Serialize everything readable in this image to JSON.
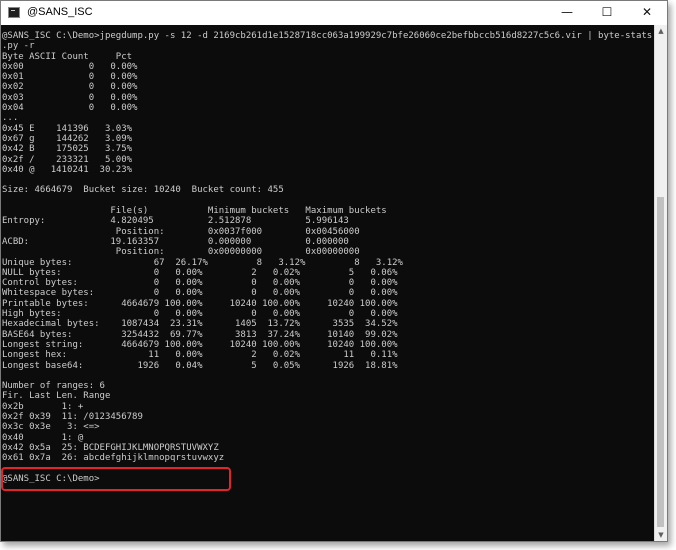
{
  "window": {
    "title": "@SANS_ISC"
  },
  "controls": {
    "minimize": "—",
    "maximize": "☐",
    "close": "✕"
  },
  "terminal": {
    "lines": [
      "@SANS_ISC C:\\Demo>jpegdump.py -s 12 -d 2169cb261d1e1528718cc063a199929c7bfe26060ce2befbbccb516d8227c5c6.vir | byte-stats",
      ".py -r",
      "Byte ASCII Count     Pct",
      "0x00            0   0.00%",
      "0x01            0   0.00%",
      "0x02            0   0.00%",
      "0x03            0   0.00%",
      "0x04            0   0.00%",
      "...",
      "0x45 E    141396   3.03%",
      "0x67 g    144262   3.09%",
      "0x42 B    175025   3.75%",
      "0x2f /    233321   5.00%",
      "0x40 @   1410241  30.23%",
      "",
      "Size: 4664679  Bucket size: 10240  Bucket count: 455",
      "",
      "                    File(s)           Minimum buckets   Maximum buckets",
      "Entropy:            4.820495          2.512878          5.996143",
      "                     Position:        0x0037f000        0x00456000",
      "ACBD:               19.163357         0.000000          0.000000",
      "                     Position:        0x00000000        0x00000000",
      "Unique bytes:               67  26.17%         8   3.12%         8   3.12%",
      "NULL bytes:                 0   0.00%         2   0.02%         5   0.06%",
      "Control bytes:              0   0.00%         0   0.00%         0   0.00%",
      "Whitespace bytes:           0   0.00%         0   0.00%         0   0.00%",
      "Printable bytes:      4664679 100.00%     10240 100.00%     10240 100.00%",
      "High bytes:                 0   0.00%         0   0.00%         0   0.00%",
      "Hexadecimal bytes:    1087434  23.31%      1405  13.72%      3535  34.52%",
      "BASE64 bytes:         3254432  69.77%      3813  37.24%     10140  99.02%",
      "Longest string:       4664679 100.00%     10240 100.00%     10240 100.00%",
      "Longest hex:               11   0.00%         2   0.02%        11   0.11%",
      "Longest base64:          1926   0.04%         5   0.05%      1926  18.81%",
      "",
      "Number of ranges: 6",
      "Fir. Last Len. Range",
      "0x2b       1: +",
      "0x2f 0x39  11: /0123456789",
      "0x3c 0x3e   3: <=>",
      "0x40       1: @",
      "0x42 0x5a  25: BCDEFGHIJKLMNOPQRSTUVWXYZ",
      "0x61 0x7a  26: abcdefghijklmnopqrstuvwxyz",
      "",
      "@SANS_ISC C:\\Demo>"
    ]
  }
}
